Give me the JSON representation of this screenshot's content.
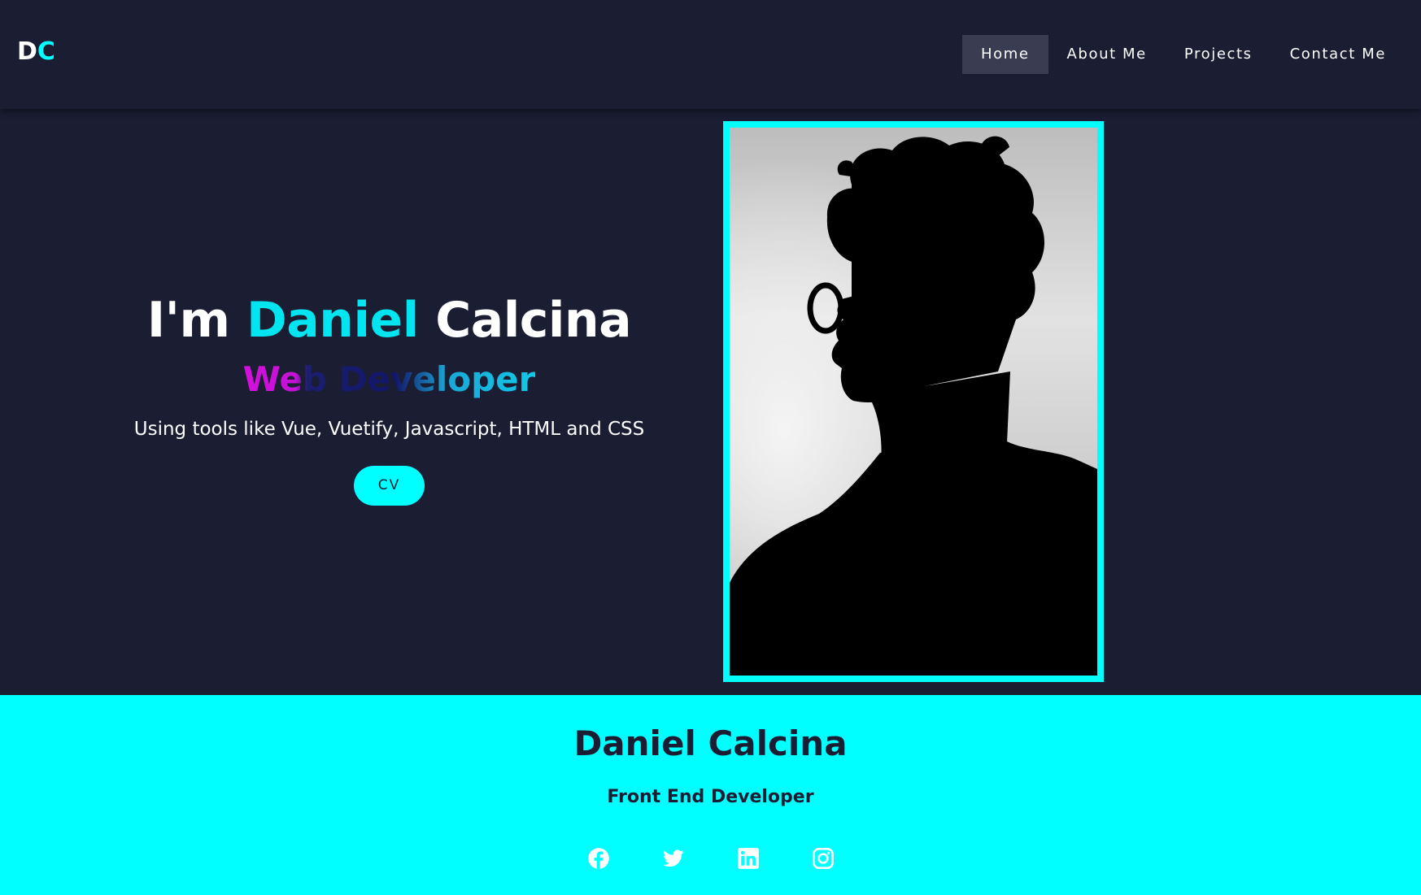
{
  "logo": {
    "part1": "D",
    "part2": "C"
  },
  "nav": {
    "items": [
      {
        "label": "Home",
        "active": true
      },
      {
        "label": "About Me"
      },
      {
        "label": "Projects"
      },
      {
        "label": "Contact Me"
      }
    ]
  },
  "hero": {
    "headline_prefix": "I'm",
    "headline_first": "Daniel",
    "headline_last": "Calcina",
    "role": "Web Developer",
    "tagline": "Using tools like Vue, Vuetify, Javascript, HTML and CSS",
    "cv_label": "CV",
    "photo_icon": "profile-silhouette-photo"
  },
  "footer": {
    "name": "Daniel Calcina",
    "role": "Front End Developer",
    "socials": [
      {
        "icon": "facebook-icon"
      },
      {
        "icon": "twitter-icon"
      },
      {
        "icon": "linkedin-icon"
      },
      {
        "icon": "instagram-icon"
      }
    ]
  },
  "colors": {
    "background": "#1b1d33",
    "accent": "#00ffff",
    "nav_active": "#3a3c52",
    "text": "#ffffff"
  }
}
